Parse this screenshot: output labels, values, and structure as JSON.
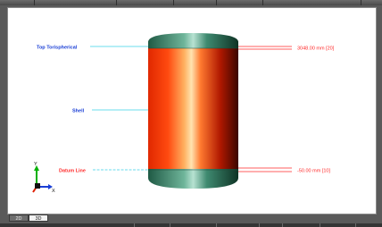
{
  "labels": {
    "top_head": "Top Torispherical",
    "shell": "Shell",
    "datum": "Datum Line"
  },
  "dimensions": {
    "top": "3048.00 mm  [20]",
    "bottom": "-50.00 mm  [10]"
  },
  "axis": {
    "y": "Y",
    "x": "X"
  },
  "tabs": [
    {
      "label": "2D View",
      "active": false
    },
    {
      "label": "3D View",
      "active": true
    }
  ],
  "colors": {
    "label_text": "#1a3fd6",
    "leader_line": "#3ad0e8",
    "dimension": "#ff2a2a",
    "shell": "#ff3a00",
    "heads": "#2f7a5e"
  }
}
